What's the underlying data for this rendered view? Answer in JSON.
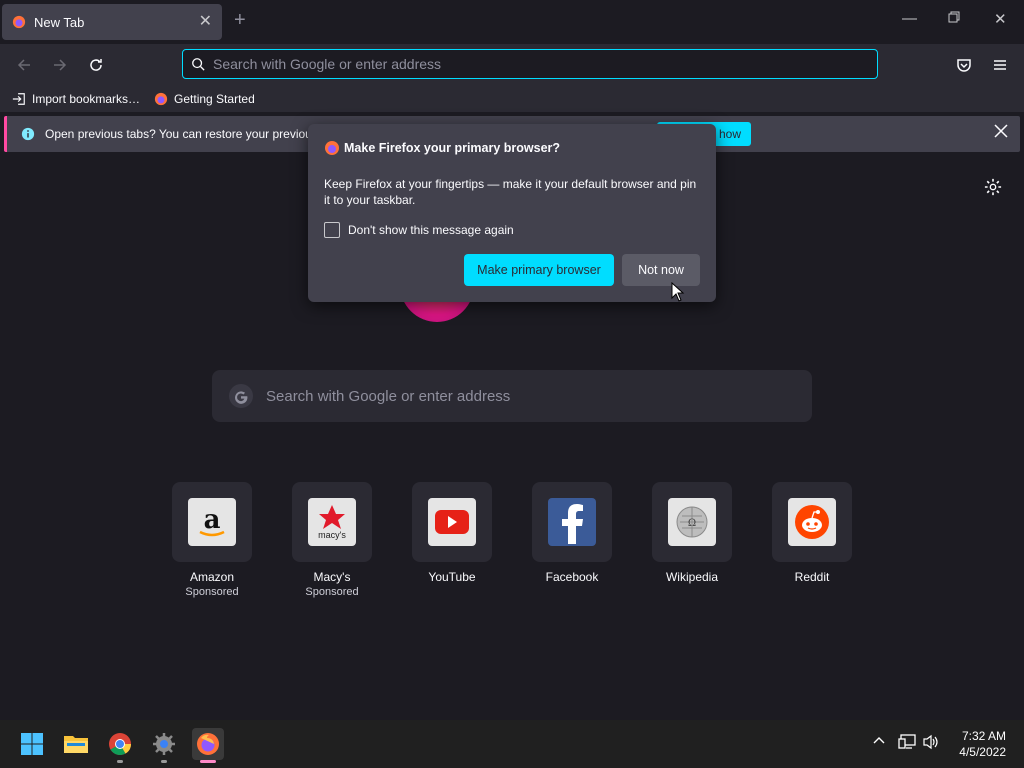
{
  "browser": {
    "tab_title": "New Tab",
    "url_placeholder": "Search with Google or enter address"
  },
  "bookmarks": [
    {
      "label": "Import bookmarks…",
      "icon": "import-icon"
    },
    {
      "label": "Getting Started",
      "icon": "firefox-icon"
    }
  ],
  "infobar": {
    "message": "Open previous tabs? You can restore your previous",
    "button_label": "how"
  },
  "dialog": {
    "title": "Make Firefox your primary browser?",
    "body": "Keep Firefox at your fingertips — make it your default browser and pin it to your taskbar.",
    "checkbox_label": "Don't show this message again",
    "primary_button": "Make primary browser",
    "secondary_button": "Not now"
  },
  "newtab": {
    "search_placeholder": "Search with Google or enter address",
    "tiles": [
      {
        "name": "Amazon",
        "sponsored": "Sponsored",
        "icon": "amazon-icon"
      },
      {
        "name": "Macy's",
        "sponsored": "Sponsored",
        "icon": "macys-icon",
        "icon_text": "macy's"
      },
      {
        "name": "YouTube",
        "sponsored": "",
        "icon": "youtube-icon"
      },
      {
        "name": "Facebook",
        "sponsored": "",
        "icon": "facebook-icon"
      },
      {
        "name": "Wikipedia",
        "sponsored": "",
        "icon": "wikipedia-icon"
      },
      {
        "name": "Reddit",
        "sponsored": "",
        "icon": "reddit-icon"
      }
    ]
  },
  "taskbar": {
    "time": "7:32 AM",
    "date": "4/5/2022"
  },
  "colors": {
    "accent": "#00ddff",
    "background": "#1c1b22",
    "toolbar": "#2b2a33",
    "panel": "#42414d"
  }
}
